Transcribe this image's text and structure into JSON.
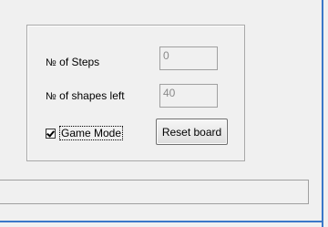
{
  "window": {
    "accent_color": "#3a78c8"
  },
  "settings": {
    "steps_label": "of Steps",
    "steps_prefix": "№",
    "steps_value": "0",
    "shapes_label": "of shapes left",
    "shapes_prefix": "№",
    "shapes_value": "40",
    "game_mode_label": "Game Mode",
    "game_mode_checked": true,
    "reset_button_label": "Reset board"
  },
  "status": {
    "text": ""
  }
}
